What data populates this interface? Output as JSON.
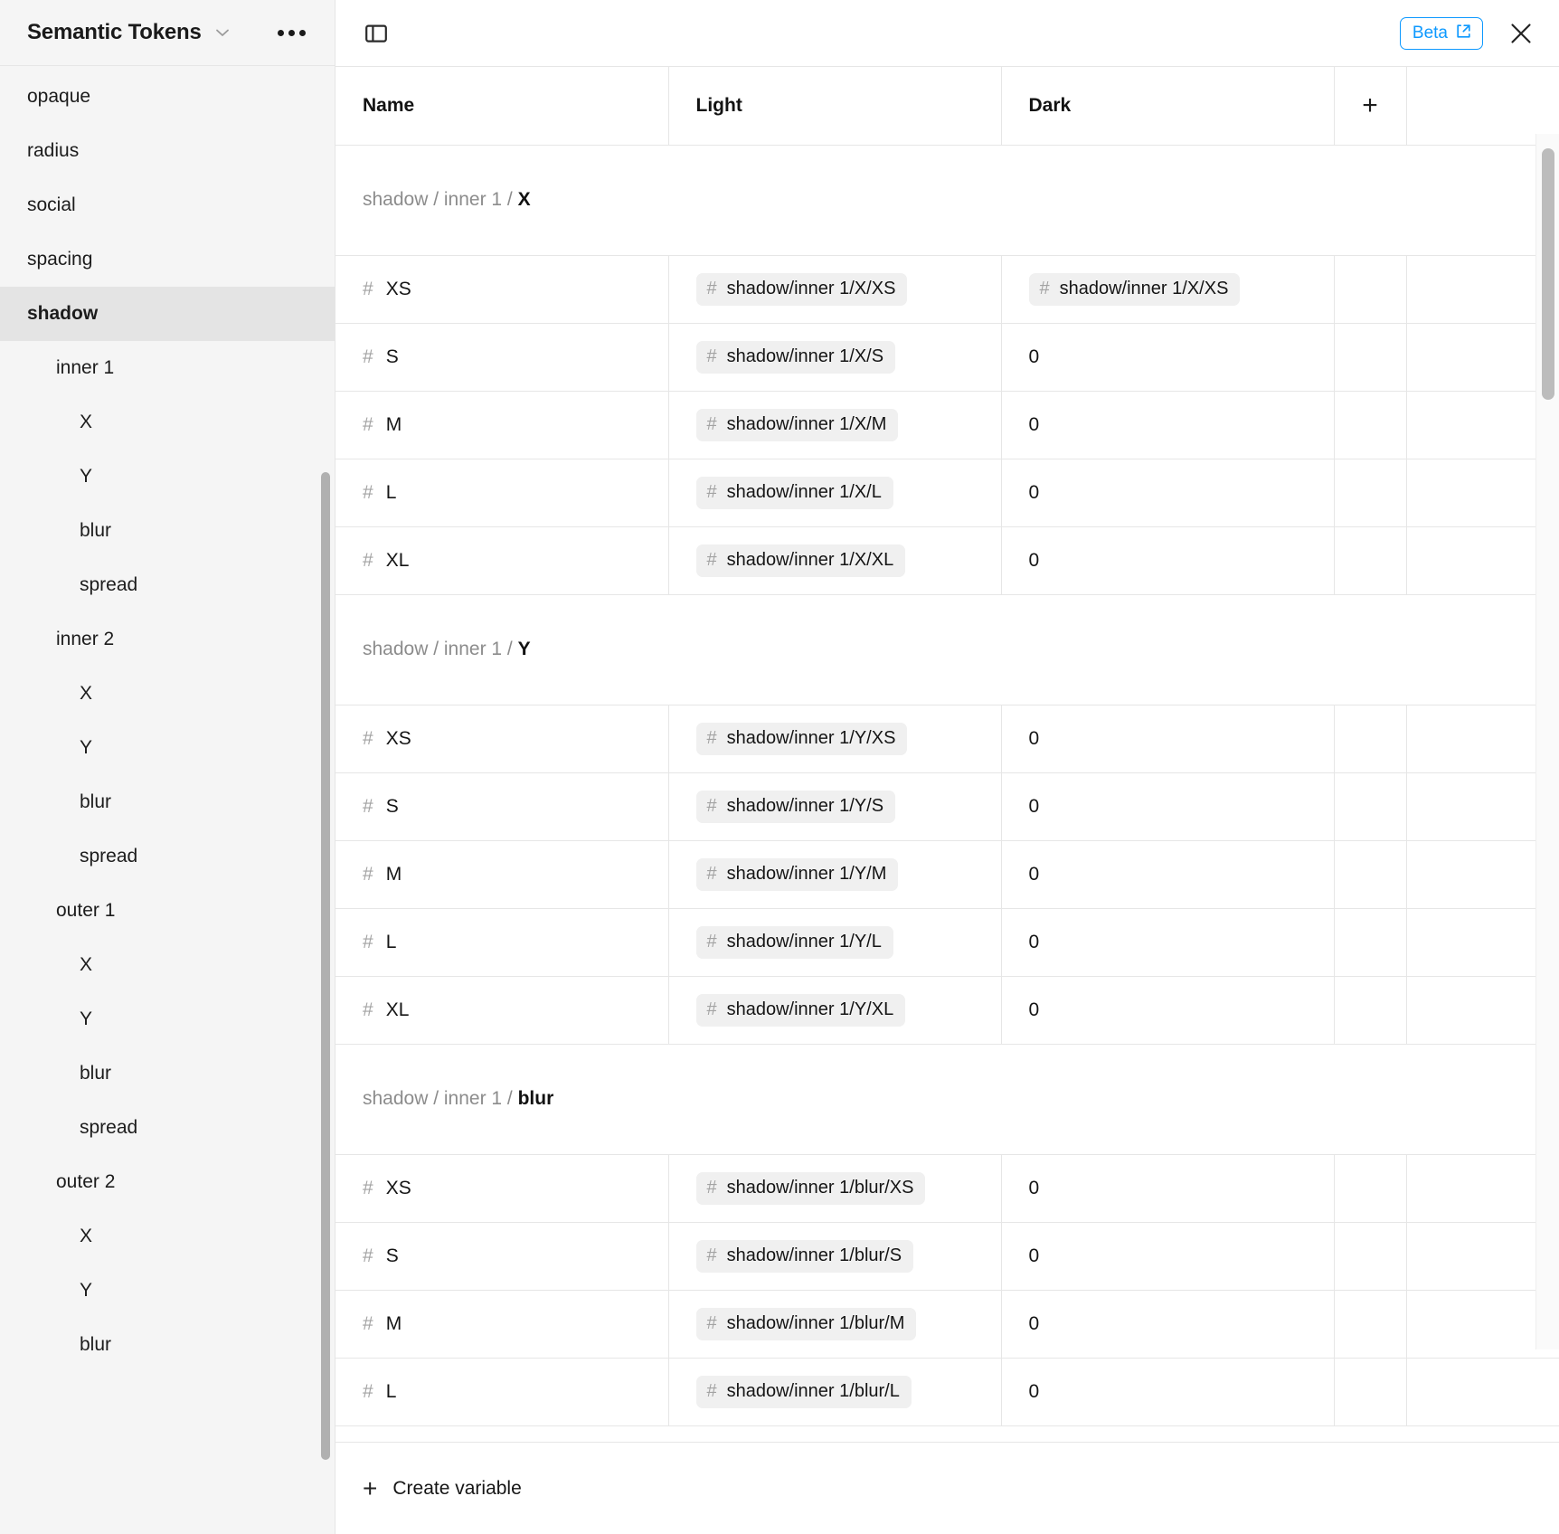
{
  "sidebar": {
    "title": "Semantic Tokens",
    "chevron_icon": "chevron-down-icon",
    "more_icon": "more-options-icon",
    "items": [
      {
        "label": "opaque",
        "level": 0,
        "active": false
      },
      {
        "label": "radius",
        "level": 0,
        "active": false
      },
      {
        "label": "social",
        "level": 0,
        "active": false
      },
      {
        "label": "spacing",
        "level": 0,
        "active": false
      },
      {
        "label": "shadow",
        "level": 0,
        "active": true
      },
      {
        "label": "inner 1",
        "level": 1,
        "active": false
      },
      {
        "label": "X",
        "level": 2,
        "active": false
      },
      {
        "label": "Y",
        "level": 2,
        "active": false
      },
      {
        "label": "blur",
        "level": 2,
        "active": false
      },
      {
        "label": "spread",
        "level": 2,
        "active": false
      },
      {
        "label": "inner 2",
        "level": 1,
        "active": false
      },
      {
        "label": "X",
        "level": 2,
        "active": false
      },
      {
        "label": "Y",
        "level": 2,
        "active": false
      },
      {
        "label": "blur",
        "level": 2,
        "active": false
      },
      {
        "label": "spread",
        "level": 2,
        "active": false
      },
      {
        "label": "outer 1",
        "level": 1,
        "active": false
      },
      {
        "label": "X",
        "level": 2,
        "active": false
      },
      {
        "label": "Y",
        "level": 2,
        "active": false
      },
      {
        "label": "blur",
        "level": 2,
        "active": false
      },
      {
        "label": "spread",
        "level": 2,
        "active": false
      },
      {
        "label": "outer 2",
        "level": 1,
        "active": false
      },
      {
        "label": "X",
        "level": 2,
        "active": false
      },
      {
        "label": "Y",
        "level": 2,
        "active": false
      },
      {
        "label": "blur",
        "level": 2,
        "active": false
      }
    ]
  },
  "topbar": {
    "panel_toggle_icon": "panel-left-toggle-icon",
    "beta_label": "Beta",
    "beta_external_icon": "external-link-icon",
    "close_icon": "close-icon"
  },
  "table": {
    "columns": [
      "Name",
      "Light",
      "Dark"
    ],
    "add_column_icon": "plus-icon",
    "hash_icon": "hash-icon",
    "groups": [
      {
        "path_prefix": "shadow / inner 1 / ",
        "path_last": "X",
        "rows": [
          {
            "name": "XS",
            "light": "shadow/inner 1/X/XS",
            "light_type": "chip",
            "dark": "shadow/inner 1/X/XS",
            "dark_type": "chip"
          },
          {
            "name": "S",
            "light": "shadow/inner 1/X/S",
            "light_type": "chip",
            "dark": "0",
            "dark_type": "text"
          },
          {
            "name": "M",
            "light": "shadow/inner 1/X/M",
            "light_type": "chip",
            "dark": "0",
            "dark_type": "text"
          },
          {
            "name": "L",
            "light": "shadow/inner 1/X/L",
            "light_type": "chip",
            "dark": "0",
            "dark_type": "text"
          },
          {
            "name": "XL",
            "light": "shadow/inner 1/X/XL",
            "light_type": "chip",
            "dark": "0",
            "dark_type": "text"
          }
        ]
      },
      {
        "path_prefix": "shadow / inner 1 / ",
        "path_last": "Y",
        "rows": [
          {
            "name": "XS",
            "light": "shadow/inner 1/Y/XS",
            "light_type": "chip",
            "dark": "0",
            "dark_type": "text"
          },
          {
            "name": "S",
            "light": "shadow/inner 1/Y/S",
            "light_type": "chip",
            "dark": "0",
            "dark_type": "text"
          },
          {
            "name": "M",
            "light": "shadow/inner 1/Y/M",
            "light_type": "chip",
            "dark": "0",
            "dark_type": "text"
          },
          {
            "name": "L",
            "light": "shadow/inner 1/Y/L",
            "light_type": "chip",
            "dark": "0",
            "dark_type": "text"
          },
          {
            "name": "XL",
            "light": "shadow/inner 1/Y/XL",
            "light_type": "chip",
            "dark": "0",
            "dark_type": "text"
          }
        ]
      },
      {
        "path_prefix": "shadow / inner 1 / ",
        "path_last": "blur",
        "rows": [
          {
            "name": "XS",
            "light": "shadow/inner 1/blur/XS",
            "light_type": "chip",
            "dark": "0",
            "dark_type": "text"
          },
          {
            "name": "S",
            "light": "shadow/inner 1/blur/S",
            "light_type": "chip",
            "dark": "0",
            "dark_type": "text"
          },
          {
            "name": "M",
            "light": "shadow/inner 1/blur/M",
            "light_type": "chip",
            "dark": "0",
            "dark_type": "text"
          },
          {
            "name": "L",
            "light": "shadow/inner 1/blur/L",
            "light_type": "chip",
            "dark": "0",
            "dark_type": "text"
          }
        ]
      }
    ]
  },
  "footer": {
    "create_variable_label": "Create variable",
    "create_icon": "plus-icon"
  },
  "colors": {
    "accent": "#0d99ff",
    "sidebar_bg": "#f5f5f5",
    "active_row": "#e4e4e4",
    "chip_bg": "#f0f0f0",
    "border": "#e6e6e6"
  }
}
